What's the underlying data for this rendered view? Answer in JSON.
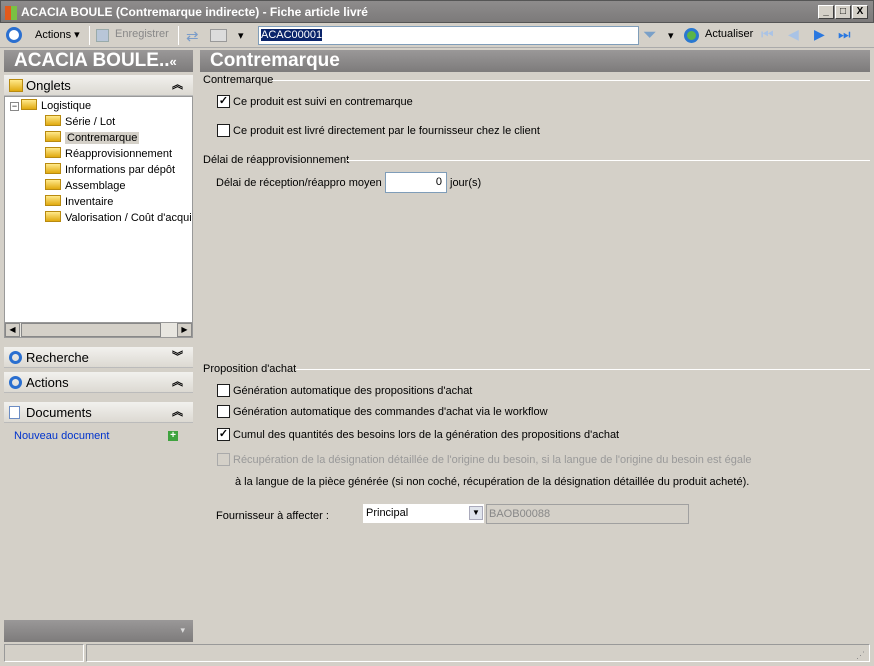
{
  "window": {
    "title": "ACACIA BOULE (Contremarque indirecte) -  Fiche article livré",
    "minimize": "_",
    "maximize": "□",
    "close": "X"
  },
  "toolbar": {
    "actions": "Actions",
    "save": "Enregistrer",
    "search_value": "ACAC00001",
    "refresh": "Actualiser"
  },
  "left": {
    "title": "ACACIA BOULE..",
    "collapse": "«",
    "tabs_section": "Onglets",
    "tree": {
      "root": "Logistique",
      "children": [
        "Série / Lot",
        "Contremarque",
        "Réapprovisionnement",
        "Informations par dépôt",
        "Assemblage",
        "Inventaire",
        "Valorisation / Coût d'acquis"
      ],
      "selected": "Contremarque"
    },
    "search_section": "Recherche",
    "actions_section": "Actions",
    "documents_section": "Documents",
    "new_document": "Nouveau document"
  },
  "main": {
    "title": "Contremarque",
    "contremarque": {
      "legend": "Contremarque",
      "options": [
        {
          "label": "Ce produit est suivi en contremarque",
          "checked": true
        },
        {
          "label": "Ce produit est livré directement par le fournisseur chez le client",
          "checked": false
        }
      ]
    },
    "delai": {
      "legend": "Délai de réapprovisionnement",
      "label": "Délai de réception/réappro moyen :",
      "value": "0",
      "unit": "jour(s)"
    },
    "proposition": {
      "legend": "Proposition d'achat",
      "options": [
        {
          "label": "Génération automatique des propositions d'achat",
          "checked": false
        },
        {
          "label": "Génération automatique des commandes d'achat via le workflow",
          "checked": false
        },
        {
          "label": "Cumul des quantités des besoins lors de la génération des propositions d'achat",
          "checked": true
        },
        {
          "label": "Récupération de la désignation détaillée de l'origine du besoin, si la langue de l'origine du besoin est égale",
          "checked": false,
          "disabled": true
        }
      ],
      "continuation": "à la langue de la pièce générée (si non coché, récupération de la désignation détaillée du produit acheté).",
      "supplier_label": "Fournisseur à affecter :",
      "supplier_select": "Principal",
      "supplier_code": "BAOB00088"
    }
  }
}
